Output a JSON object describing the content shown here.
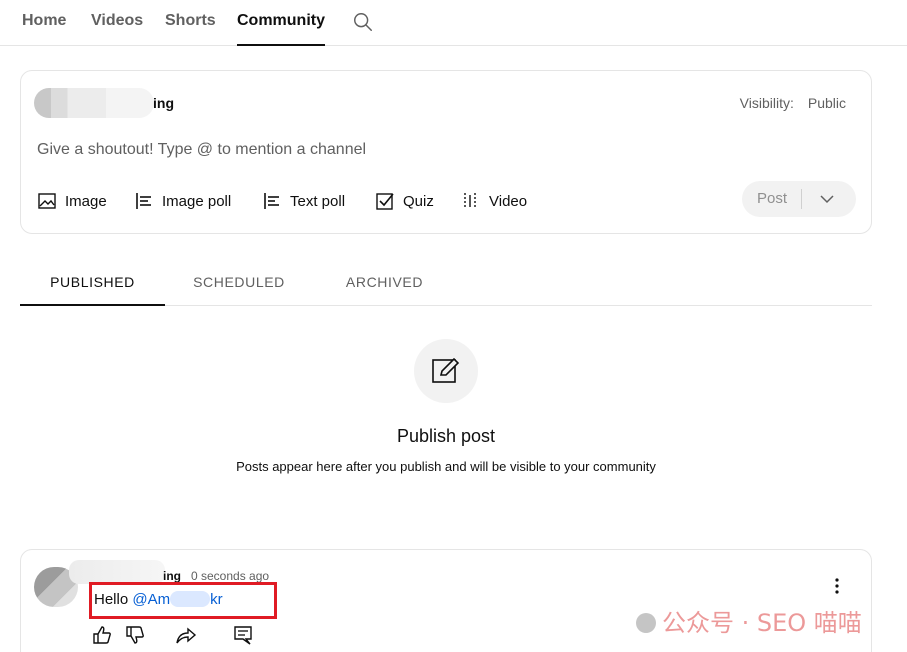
{
  "nav": {
    "tabs": [
      {
        "label": "Home"
      },
      {
        "label": "Videos"
      },
      {
        "label": "Shorts"
      },
      {
        "label": "Community",
        "active": true
      }
    ],
    "search_icon": "search-icon"
  },
  "composer": {
    "channel_name_visible": "ing",
    "visibility_label": "Visibility:",
    "visibility_value": "Public",
    "input_placeholder": "Give a shoutout! Type @ to mention a channel",
    "tools": [
      {
        "label": "Image",
        "icon": "image-icon"
      },
      {
        "label": "Image poll",
        "icon": "image-poll-icon"
      },
      {
        "label": "Text poll",
        "icon": "text-poll-icon"
      },
      {
        "label": "Quiz",
        "icon": "quiz-icon"
      },
      {
        "label": "Video",
        "icon": "video-icon"
      }
    ],
    "post_label": "Post"
  },
  "subtabs": [
    {
      "label": "PUBLISHED",
      "active": true
    },
    {
      "label": "SCHEDULED"
    },
    {
      "label": "ARCHIVED"
    }
  ],
  "empty_state": {
    "title": "Publish post",
    "description": "Posts appear here after you publish and will be visible to your community"
  },
  "post": {
    "channel_name_visible": "ing",
    "time": "0 seconds ago",
    "text_prefix": "Hello ",
    "mention_start": "@Am",
    "mention_end": "kr"
  },
  "watermark": "公众号 · SEO 喵喵",
  "colors": {
    "accent_link": "#065fd4",
    "highlight": "#e01b24",
    "text": "#0f0f0f",
    "muted": "#606060"
  }
}
